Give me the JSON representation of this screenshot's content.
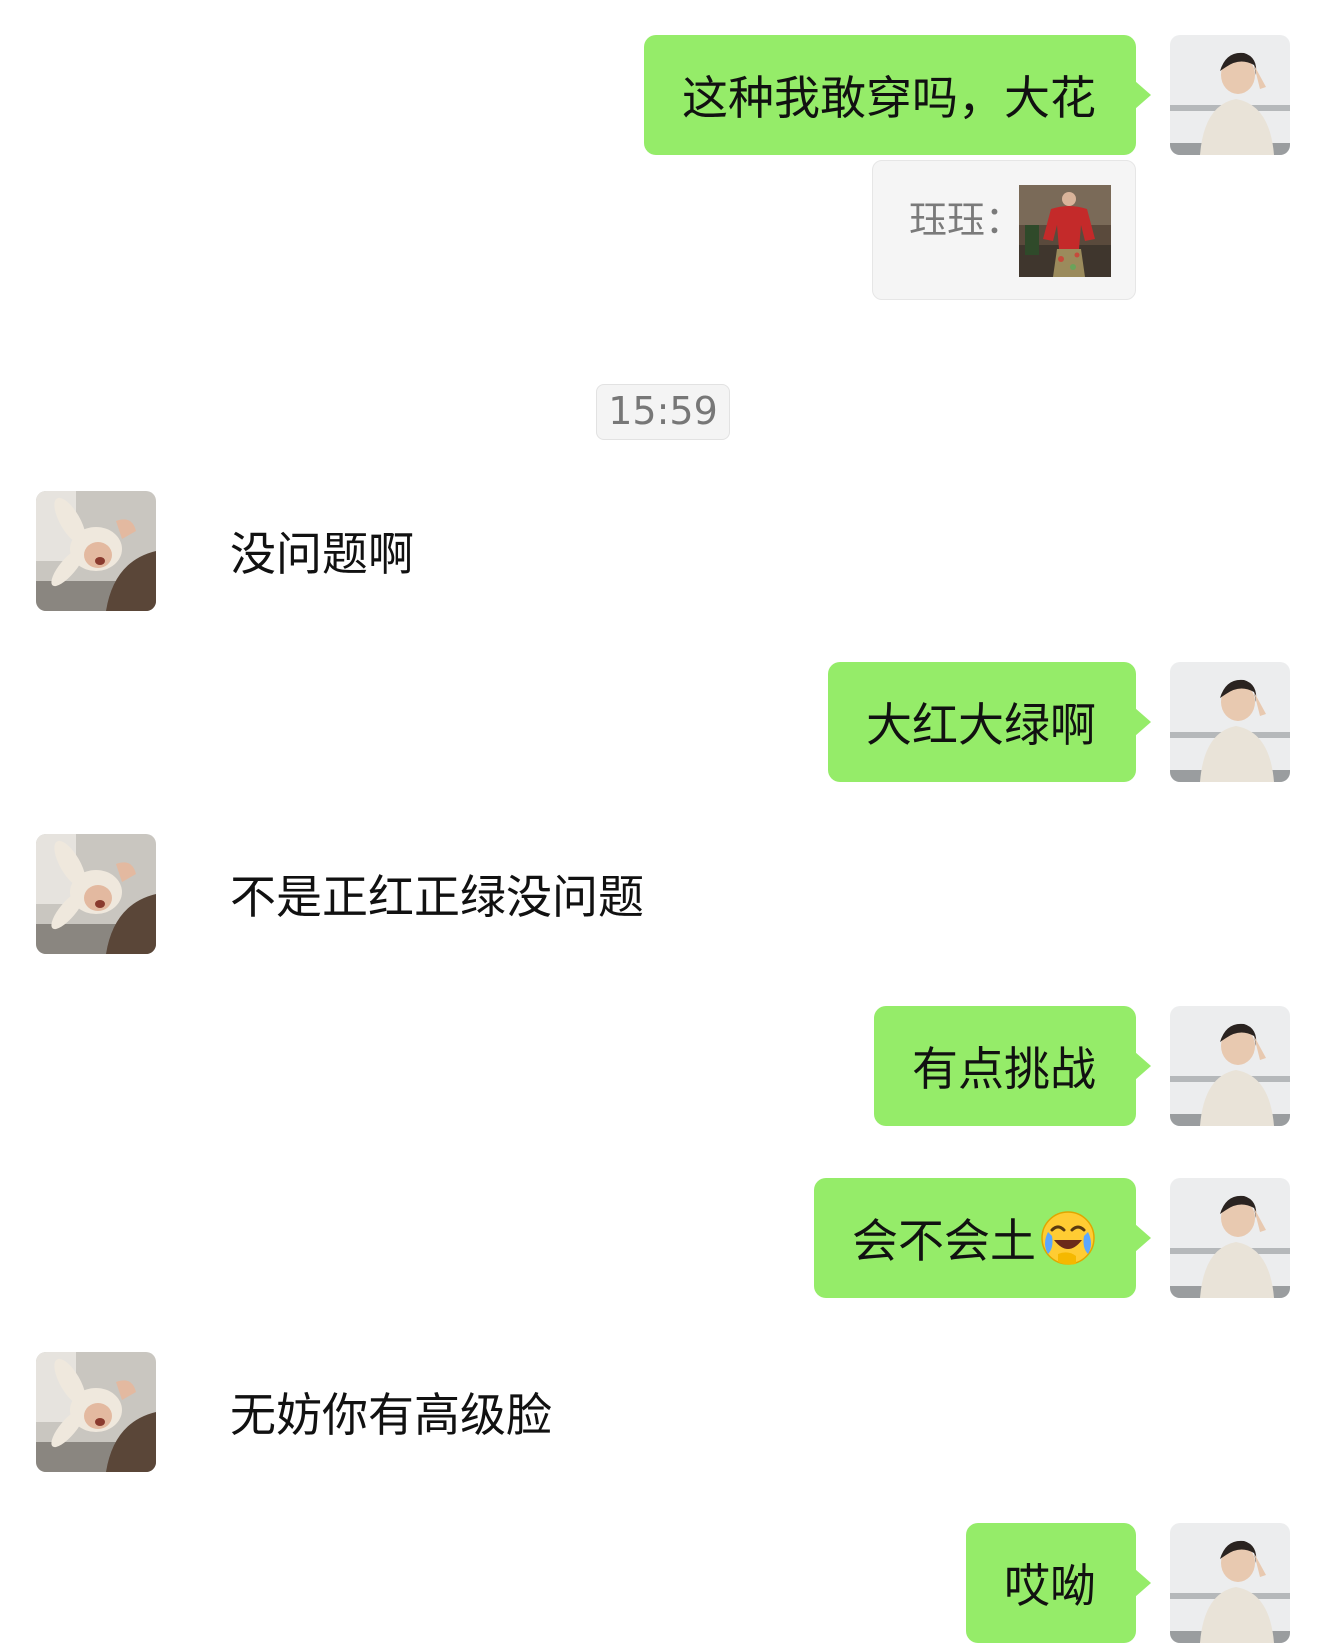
{
  "messages": [
    {
      "id": "m1",
      "side": "right",
      "text": "这种我敢穿吗，大花"
    },
    {
      "id": "m2",
      "side": "right",
      "type": "quote",
      "quote_name": "珏珏：",
      "thumb_icon": "photo-thumbnail-red-outfit"
    },
    {
      "id": "t1",
      "type": "time",
      "text": "15:59"
    },
    {
      "id": "m3",
      "side": "left",
      "text": "没问题啊"
    },
    {
      "id": "m4",
      "side": "right",
      "text": "大红大绿啊"
    },
    {
      "id": "m5",
      "side": "left",
      "text": "不是正红正绿没问题"
    },
    {
      "id": "m6",
      "side": "right",
      "text": "有点挑战"
    },
    {
      "id": "m7",
      "side": "right",
      "text": "会不会土",
      "emoji": "laughing-crying-emoji"
    },
    {
      "id": "m8",
      "side": "left",
      "text": "无妨你有高级脸"
    },
    {
      "id": "m9",
      "side": "right",
      "text": "哎呦"
    }
  ],
  "colors": {
    "my_bubble": "#95ec69",
    "background": "#ffffff",
    "time_bg": "#f4f4f4"
  },
  "icons": {
    "my_avatar": "avatar-man-photo",
    "their_avatar": "avatar-bunny-hat-photo"
  }
}
